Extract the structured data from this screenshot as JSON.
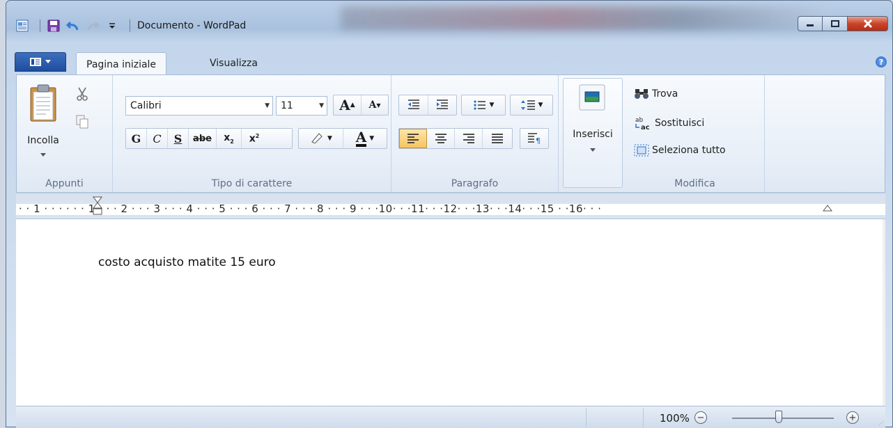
{
  "window": {
    "title": "Documento - WordPad"
  },
  "ribbon_tabs": {
    "home": "Pagina iniziale",
    "view": "Visualizza"
  },
  "clipboard": {
    "paste_label": "Incolla",
    "group_label": "Appunti"
  },
  "font": {
    "family": "Calibri",
    "size": "11",
    "bold": "G",
    "italic": "C",
    "underline": "S",
    "strikethrough": "abe",
    "grow": "A",
    "shrink": "A",
    "color_letter": "A",
    "group_label": "Tipo di carattere"
  },
  "paragraph": {
    "group_label": "Paragrafo"
  },
  "insert": {
    "label": "Inserisci"
  },
  "editing": {
    "find": "Trova",
    "replace": "Sostituisci",
    "select_all": "Seleziona tutto",
    "group_label": "Modifica"
  },
  "ruler": {
    "text": "· · 1 · · ·  · · · 1 · · · 2 · · · 3 · · · 4 · · · 5 · · · 6 · · · 7 · · · 8 · · · 9 · · ·10· · ·11· · ·12· · ·13· · ·14· · ·15  · ·16· · ·"
  },
  "document": {
    "text": "costo acquisto matite 15 euro"
  },
  "status": {
    "zoom": "100%",
    "zoom_level": 0.5
  },
  "colors": {
    "accent": "#1f4d9d",
    "active_align": "#f7c45f",
    "close_button": "#c8452b"
  }
}
